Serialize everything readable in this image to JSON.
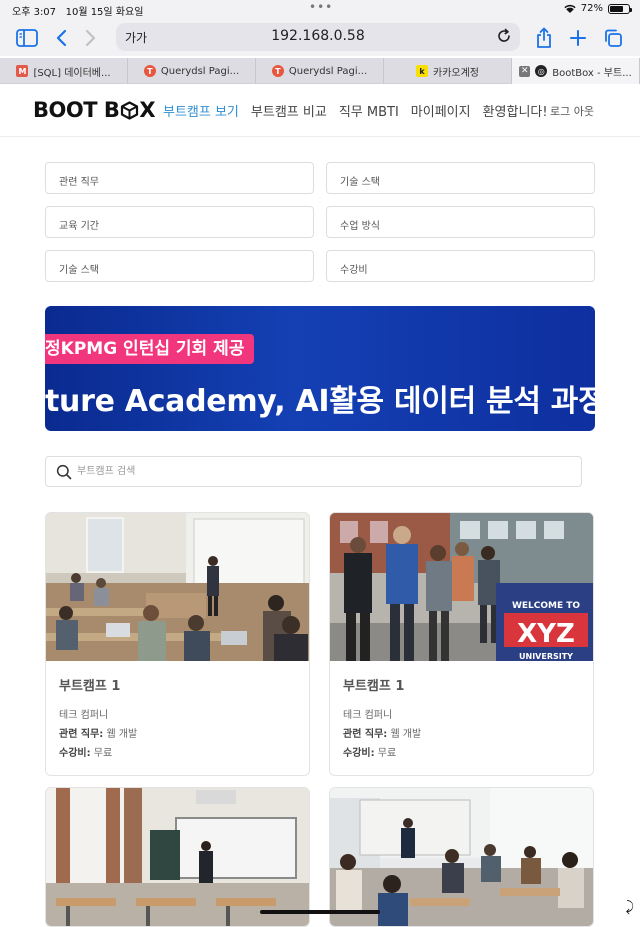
{
  "status": {
    "time": "오후 3:07",
    "date": "10월 15일 화요일",
    "battery": "72%",
    "battery_level": 0.72
  },
  "browser": {
    "text_size_label": "가가",
    "url": "192.168.0.58",
    "accent": "#1a73e8"
  },
  "tabs": [
    {
      "label": "[SQL] 데이터베...",
      "icon": "gmail-icon",
      "color": "#e25b4a"
    },
    {
      "label": "Querydsl Pagi...",
      "icon": "tistory-icon",
      "color": "#e8573f"
    },
    {
      "label": "Querydsl Pagi...",
      "icon": "tistory-icon",
      "color": "#e8573f"
    },
    {
      "label": "카카오계정",
      "icon": "kakao-icon",
      "color": "#f7e000"
    },
    {
      "label": "BootBox - 부트...",
      "icon": "bootbox-icon",
      "color": "#222222",
      "active": true
    }
  ],
  "header": {
    "logo": "BOOT B",
    "logo_tail": "X",
    "nav": [
      {
        "label": "부트캠프 보기",
        "active": true
      },
      {
        "label": "부트캠프 비교"
      },
      {
        "label": "직무 MBTI"
      },
      {
        "label": "마이페이지"
      },
      {
        "label": "환영합니다!"
      }
    ],
    "logout": "로그 아웃",
    "active_color": "#2d8fd5"
  },
  "filters": [
    {
      "label": "관련 직무"
    },
    {
      "label": "기술 스택"
    },
    {
      "label": "교육 기간"
    },
    {
      "label": "수업 방식"
    },
    {
      "label": "기술 스택"
    },
    {
      "label": "수강비"
    }
  ],
  "banner": {
    "tag": "정KPMG 인턴십 기회 제공",
    "title": "ture Academy, AI활용 데이터 분석 과정"
  },
  "search": {
    "placeholder": "부트캠프 검색"
  },
  "cards": [
    {
      "title": "부트캠프 1",
      "company": "테크 컴퍼니",
      "job_label": "관련 직무:",
      "job": "웹 개발",
      "fee_label": "수강비:",
      "fee": "무료"
    },
    {
      "title": "부트캠프 1",
      "company": "테크 컴퍼니",
      "job_label": "관련 직무:",
      "job": "웹 개발",
      "fee_label": "수강비:",
      "fee": "무료"
    },
    {
      "title": "",
      "company": "",
      "job_label": "",
      "job": "",
      "fee_label": "",
      "fee": ""
    },
    {
      "title": "",
      "company": "",
      "job_label": "",
      "job": "",
      "fee_label": "",
      "fee": ""
    }
  ],
  "card_images": [
    {
      "sign_line1": "",
      "sign_line2": "",
      "sign_line3": ""
    },
    {
      "sign_line1": "WELCOME TO",
      "sign_line2": "XYZ",
      "sign_line3": "UNIVERSITY"
    }
  ]
}
